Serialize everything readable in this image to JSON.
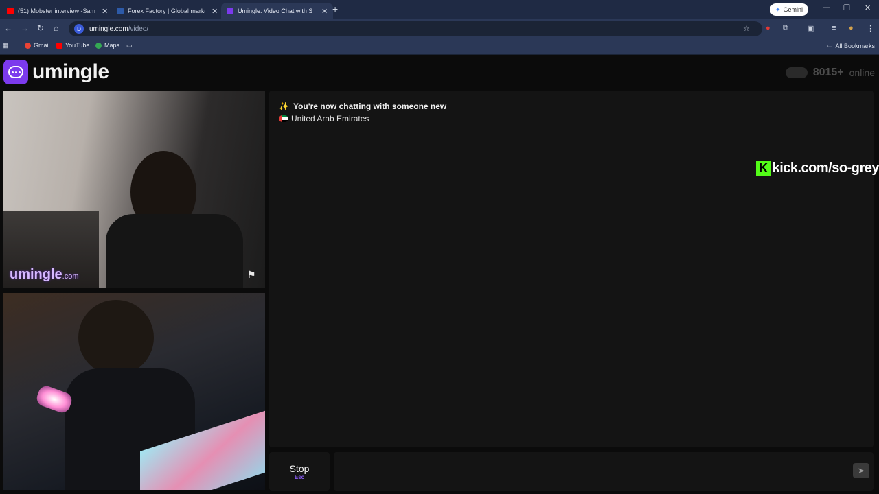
{
  "browser": {
    "tabs": [
      {
        "title": "(51) Mobster interview -Samm",
        "favicon_color": "#ff0000"
      },
      {
        "title": "Forex Factory | Global markets",
        "favicon_color": "#2d5aa8"
      },
      {
        "title": "Umingle: Video Chat with S",
        "favicon_color": "#7c3aed"
      }
    ],
    "new_tab": "+",
    "gemini_label": "Gemini",
    "url_domain": "umingle.com",
    "url_path": "/video/",
    "bookmarks": [
      "Gmail",
      "YouTube",
      "Maps"
    ],
    "all_bookmarks": "All Bookmarks"
  },
  "site": {
    "logo_text": "umingle",
    "online_count": "8015+",
    "online_label": "online"
  },
  "video": {
    "watermark_main": "umingle",
    "watermark_suffix": ".com"
  },
  "chat": {
    "status_icon": "✨",
    "status_text": "You're now chatting with someone new",
    "country": "United Arab Emirates"
  },
  "overlay": {
    "kick_letter": "K",
    "kick_text": "kick.com/so-grey"
  },
  "controls": {
    "stop_label": "Stop",
    "stop_key": "Esc",
    "send_icon": "➤"
  }
}
